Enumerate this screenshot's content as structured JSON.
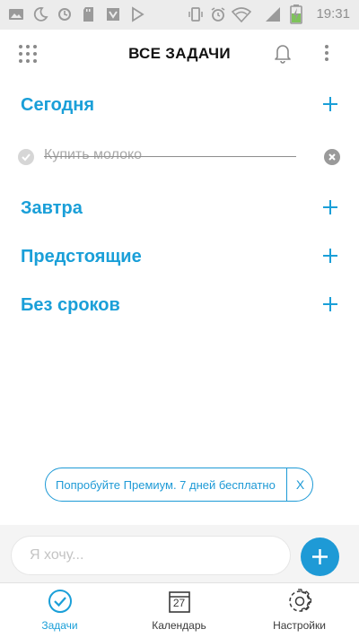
{
  "status_bar": {
    "time": "19:31",
    "icons": [
      "image-icon",
      "moon-icon",
      "sync-icon",
      "sd-card-icon",
      "download-app-icon",
      "play-store-icon",
      "vibrate-icon",
      "alarm-icon",
      "wifi-icon",
      "signal-icon",
      "battery-charging-icon"
    ]
  },
  "header": {
    "title": "ВСЕ ЗАДАЧИ",
    "icons": [
      "grid-menu-icon",
      "bell-icon",
      "more-vert-icon"
    ]
  },
  "sections": [
    {
      "title": "Сегодня"
    },
    {
      "title": "Завтра"
    },
    {
      "title": "Предстоящие"
    },
    {
      "title": "Без сроков"
    }
  ],
  "tasks": [
    {
      "text": "Купить молоко",
      "completed": true
    }
  ],
  "premium_banner": {
    "text": "Попробуйте Премиум. 7 дней бесплатно",
    "close_label": "X"
  },
  "input": {
    "placeholder": "Я хочу...",
    "value": ""
  },
  "bottom_nav": {
    "items": [
      {
        "label": "Задачи",
        "icon": "check-circle-icon",
        "active": true
      },
      {
        "label": "Календарь",
        "icon": "calendar-icon",
        "day": "27",
        "active": false
      },
      {
        "label": "Настройки",
        "icon": "gear-icon",
        "active": false
      }
    ]
  },
  "colors": {
    "accent": "#1a9fd8",
    "status_bar_bg": "#ececec",
    "status_icon": "#9a9a9a",
    "task_text": "#a9a9a9"
  }
}
